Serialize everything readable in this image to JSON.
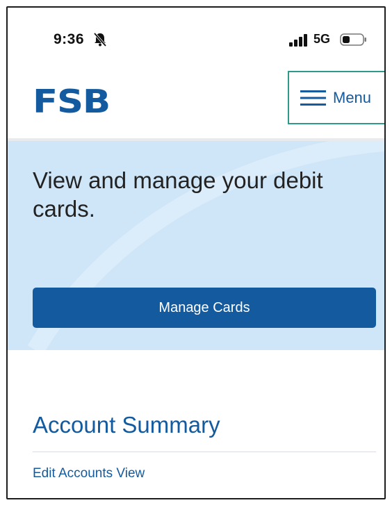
{
  "status_bar": {
    "time": "9:36",
    "bell_icon": "bell-slash-icon",
    "signal_icon": "cellular-signal-icon",
    "network": "5G",
    "battery_icon": "battery-icon"
  },
  "header": {
    "logo": "FSB",
    "menu_label": "Menu",
    "menu_icon": "hamburger-icon"
  },
  "hero": {
    "title": "View and manage your debit cards.",
    "button_label": "Manage Cards"
  },
  "account_summary": {
    "title": "Account Summary",
    "edit_link": "Edit Accounts View"
  },
  "colors": {
    "brand_blue": "#135a9f",
    "hero_background": "#cfe5f8",
    "menu_border": "#2e9b8a"
  }
}
